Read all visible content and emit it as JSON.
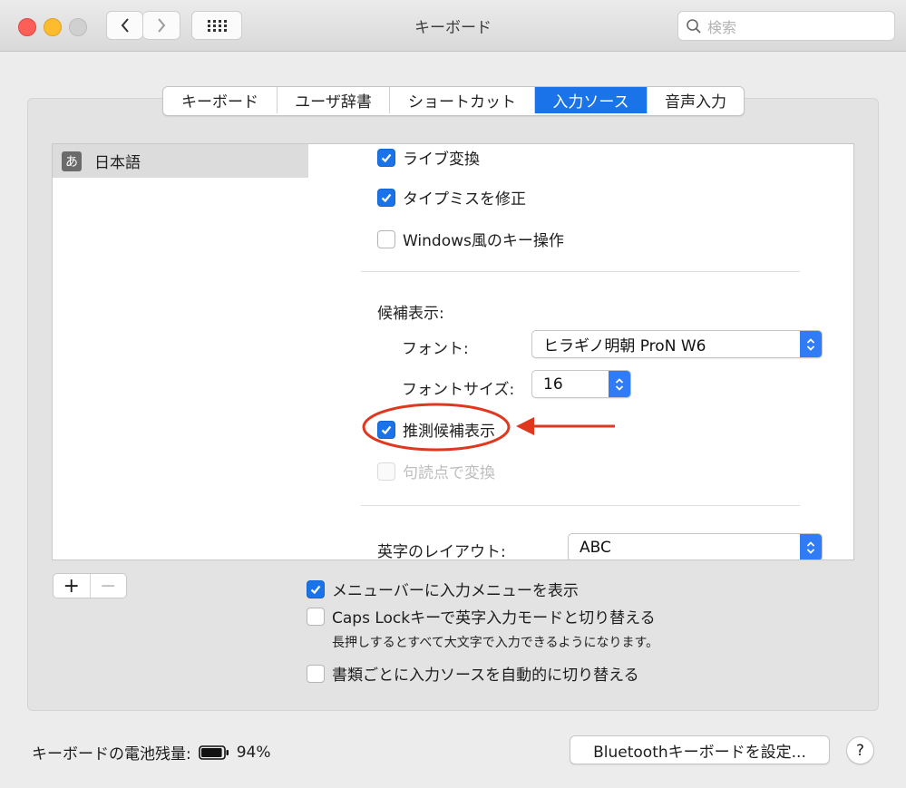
{
  "window": {
    "title": "キーボード"
  },
  "toolbar": {
    "back_icon": "chevron-left-icon",
    "forward_icon": "chevron-right-icon",
    "grid_icon": "grid-icon"
  },
  "search": {
    "placeholder": "検索",
    "icon": "search-icon"
  },
  "tabs": [
    {
      "label": "キーボード",
      "active": false
    },
    {
      "label": "ユーザ辞書",
      "active": false
    },
    {
      "label": "ショートカット",
      "active": false
    },
    {
      "label": "入力ソース",
      "active": true
    },
    {
      "label": "音声入力",
      "active": false
    }
  ],
  "sources": {
    "items": [
      {
        "badge": "あ",
        "label": "日本語",
        "selected": true
      }
    ]
  },
  "options": {
    "live_conversion": {
      "label": "ライブ変換",
      "checked": true
    },
    "fix_typos": {
      "label": "タイプミスを修正",
      "checked": true
    },
    "windows_keys": {
      "label": "Windows風のキー操作",
      "checked": false
    },
    "candidates_heading": "候補表示:",
    "font_label": "フォント:",
    "font_value": "ヒラギノ明朝 ProN W6",
    "font_size_label": "フォントサイズ:",
    "font_size_value": "16",
    "predictive": {
      "label": "推測候補表示",
      "checked": true
    },
    "punctuation": {
      "label": "句読点で変換",
      "checked": false,
      "disabled": true
    },
    "layout_label": "英字のレイアウト:",
    "layout_value": "ABC"
  },
  "list_controls": {
    "add": "+",
    "remove": "−"
  },
  "bottom": {
    "show_menu": {
      "label": "メニューバーに入力メニューを表示",
      "checked": true
    },
    "caps_lock": {
      "label": "Caps Lockキーで英字入力モードと切り替える",
      "checked": false
    },
    "caps_lock_note": "長押しするとすべて大文字で入力できるようになります。",
    "auto_switch": {
      "label": "書類ごとに入力ソースを自動的に切り替える",
      "checked": false
    }
  },
  "footer": {
    "battery_label": "キーボードの電池残量:",
    "battery_percent": "94%",
    "battery_level": 0.94,
    "bluetooth_button": "Bluetoothキーボードを設定...",
    "help_button": "?"
  },
  "colors": {
    "accent": "#1a73e8",
    "annotation": "#e0371f"
  }
}
